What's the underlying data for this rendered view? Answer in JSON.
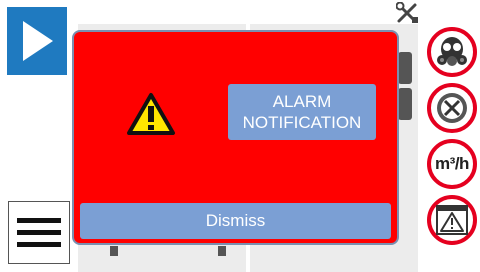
{
  "alarm": {
    "line1": "ALARM",
    "line2": "NOTIFICATION",
    "dismiss_label": "Dismiss"
  },
  "sidebar_right": {
    "flow_unit": "m³/h"
  },
  "colors": {
    "alarm_bg": "#ff0000",
    "accent_blue": "#1f7ac0",
    "label_blue": "#7b9fd4",
    "ring_red": "#e5001f"
  },
  "icons": [
    "play-icon",
    "tools-icon",
    "menu-icon",
    "gas-mask-icon",
    "fan-stop-icon",
    "flow-rate-icon",
    "alarm-warning-icon",
    "warning-icon"
  ]
}
